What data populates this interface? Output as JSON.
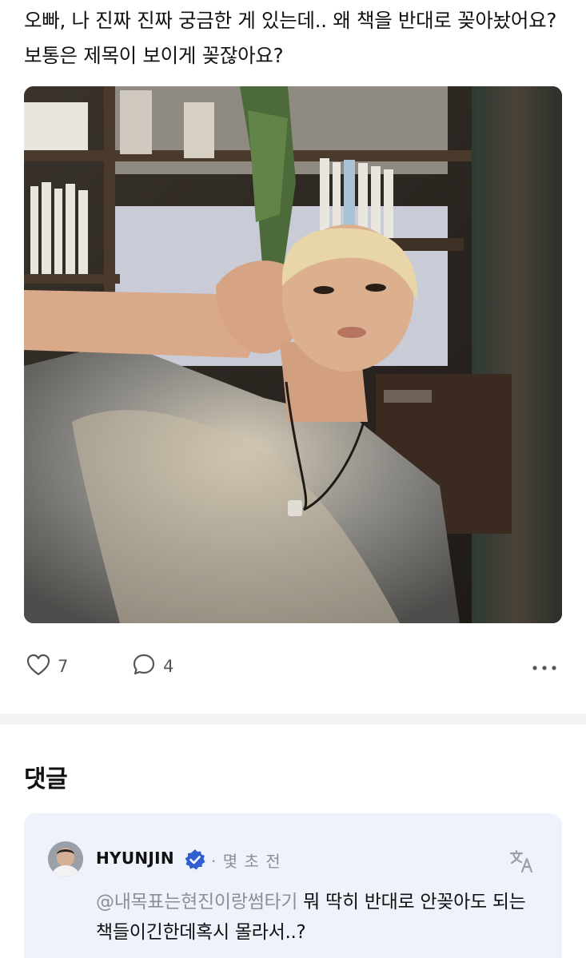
{
  "post": {
    "text": "오빠, 나 진짜 진짜 궁금한 게 있는데.. 왜 책을 반대로 꽂아놨어요? 보통은 제목이 보이게 꽂잖아요?",
    "likes": "7",
    "comments": "4"
  },
  "icons": {
    "like": "heart-outline-icon",
    "comment": "speech-bubble-icon",
    "more": "more-horizontal-icon",
    "verified": "verified-badge-icon",
    "translate": "translate-icon"
  },
  "comments_section": {
    "title": "댓글",
    "items": [
      {
        "author": "HYUNJIN",
        "time": "· 몇 초 전",
        "mention": "@내목표는현진이랑썸타기",
        "text": " 뭐 딱히 반대로 안꽂아도 되는 책들이긴한데혹시 몰라서..?"
      }
    ]
  },
  "colors": {
    "accent_verified": "#2f5fd0",
    "muted_text": "#8a8f99",
    "comment_card_bg": "#eef2fb"
  }
}
